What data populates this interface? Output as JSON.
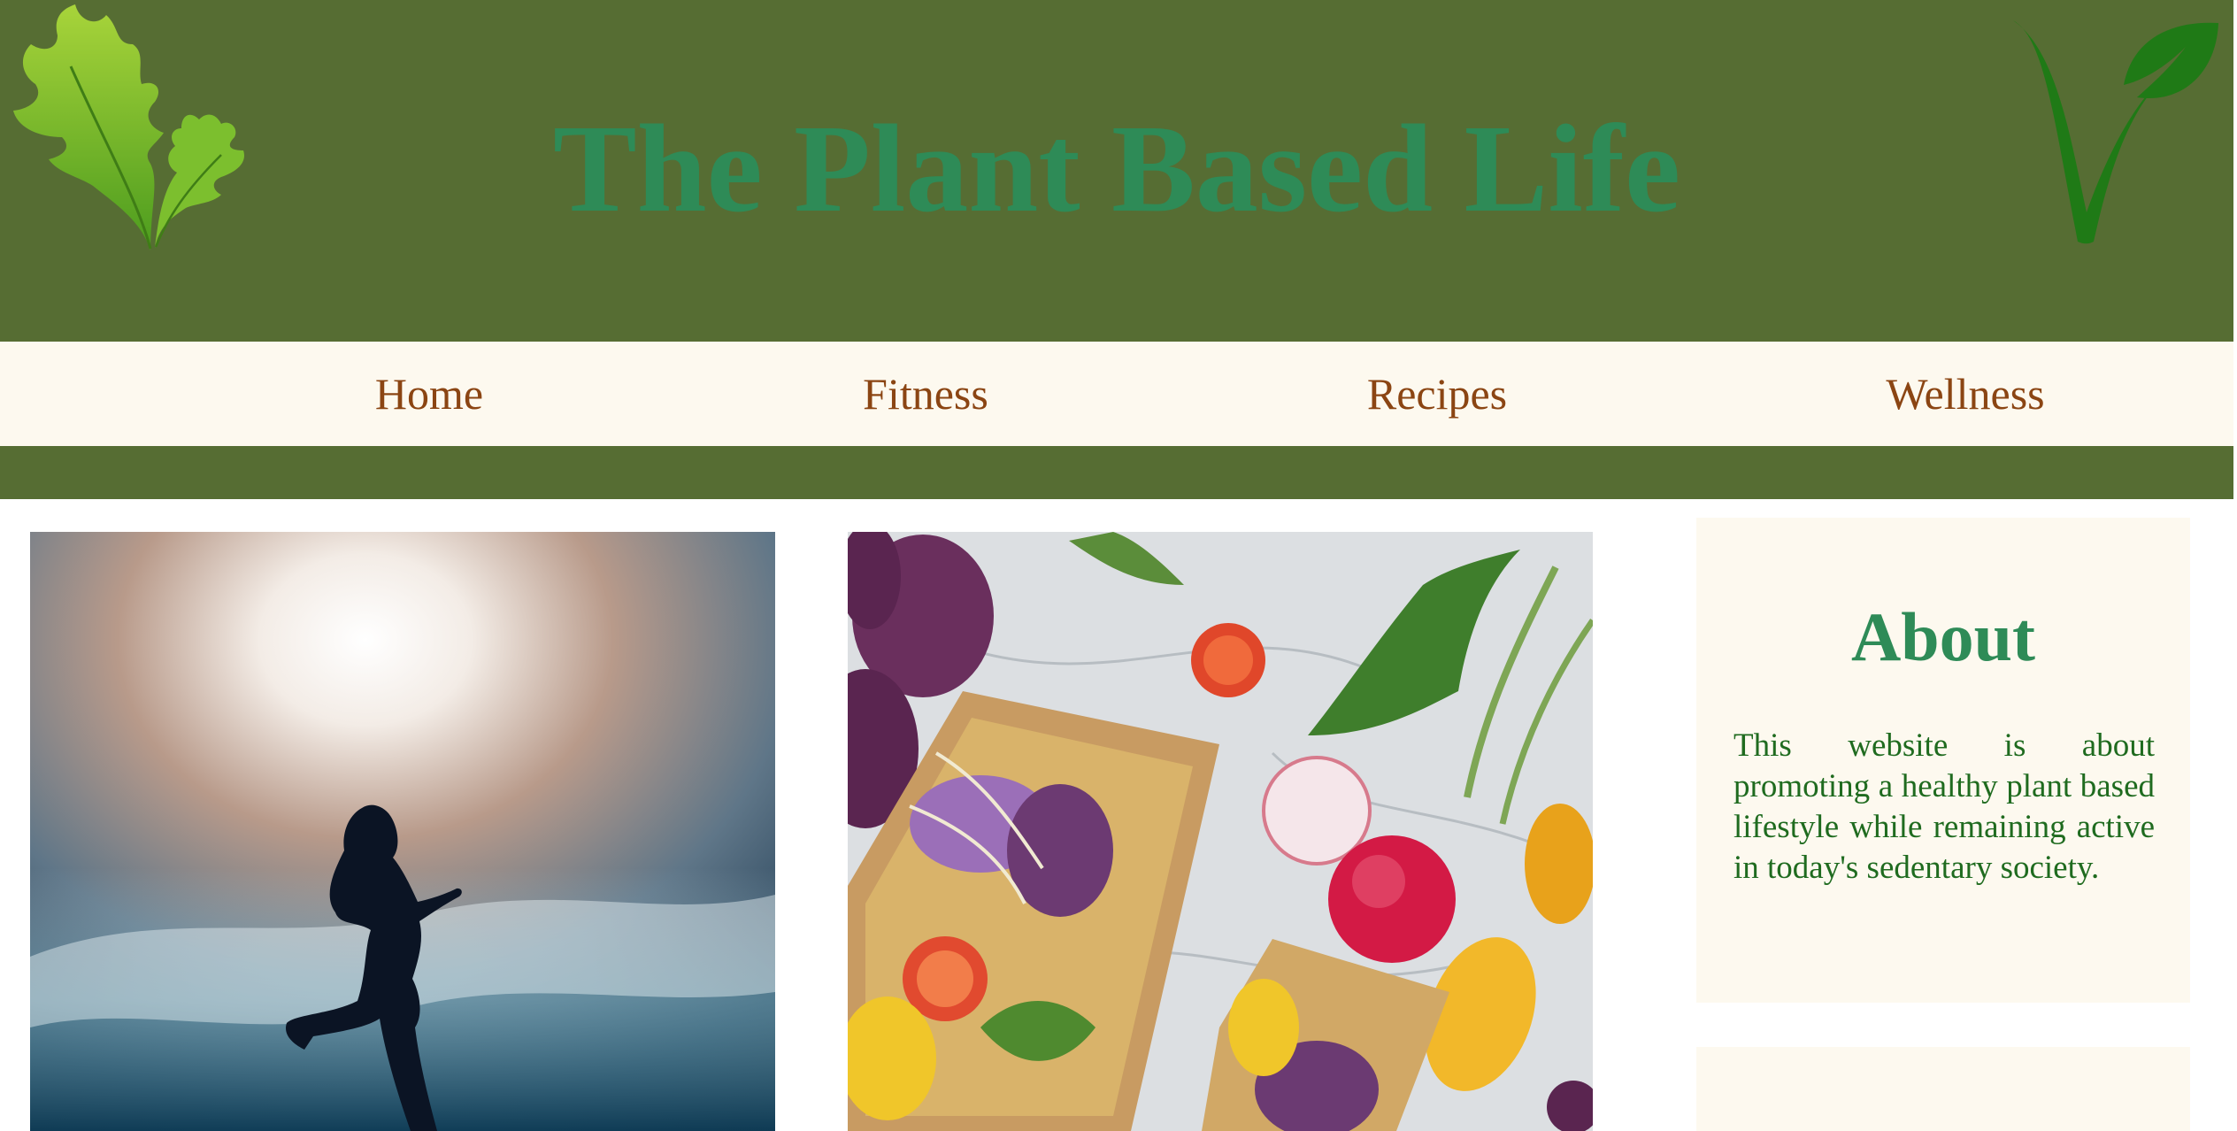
{
  "header": {
    "title": "The Plant Based Life",
    "left_logo_icon": "oak-leaf-icon",
    "right_logo_icon": "vegan-v-leaf-icon"
  },
  "nav": {
    "items": [
      {
        "label": "Home"
      },
      {
        "label": "Fitness"
      },
      {
        "label": "Recipes"
      },
      {
        "label": "Wellness"
      }
    ]
  },
  "images": {
    "runner": "runner silhouette against sky",
    "food": "vegetable toast with radishes and tomatoes"
  },
  "about": {
    "heading": "About",
    "body": "This website is about promoting a healthy plant based lifestyle while remaining active in today's sedentary society."
  },
  "colors": {
    "header_bg": "#566d33",
    "title": "#2e8b57",
    "nav_bg": "#fdf9ef",
    "nav_text": "#8b4513",
    "about_text": "#1f6b1f"
  }
}
